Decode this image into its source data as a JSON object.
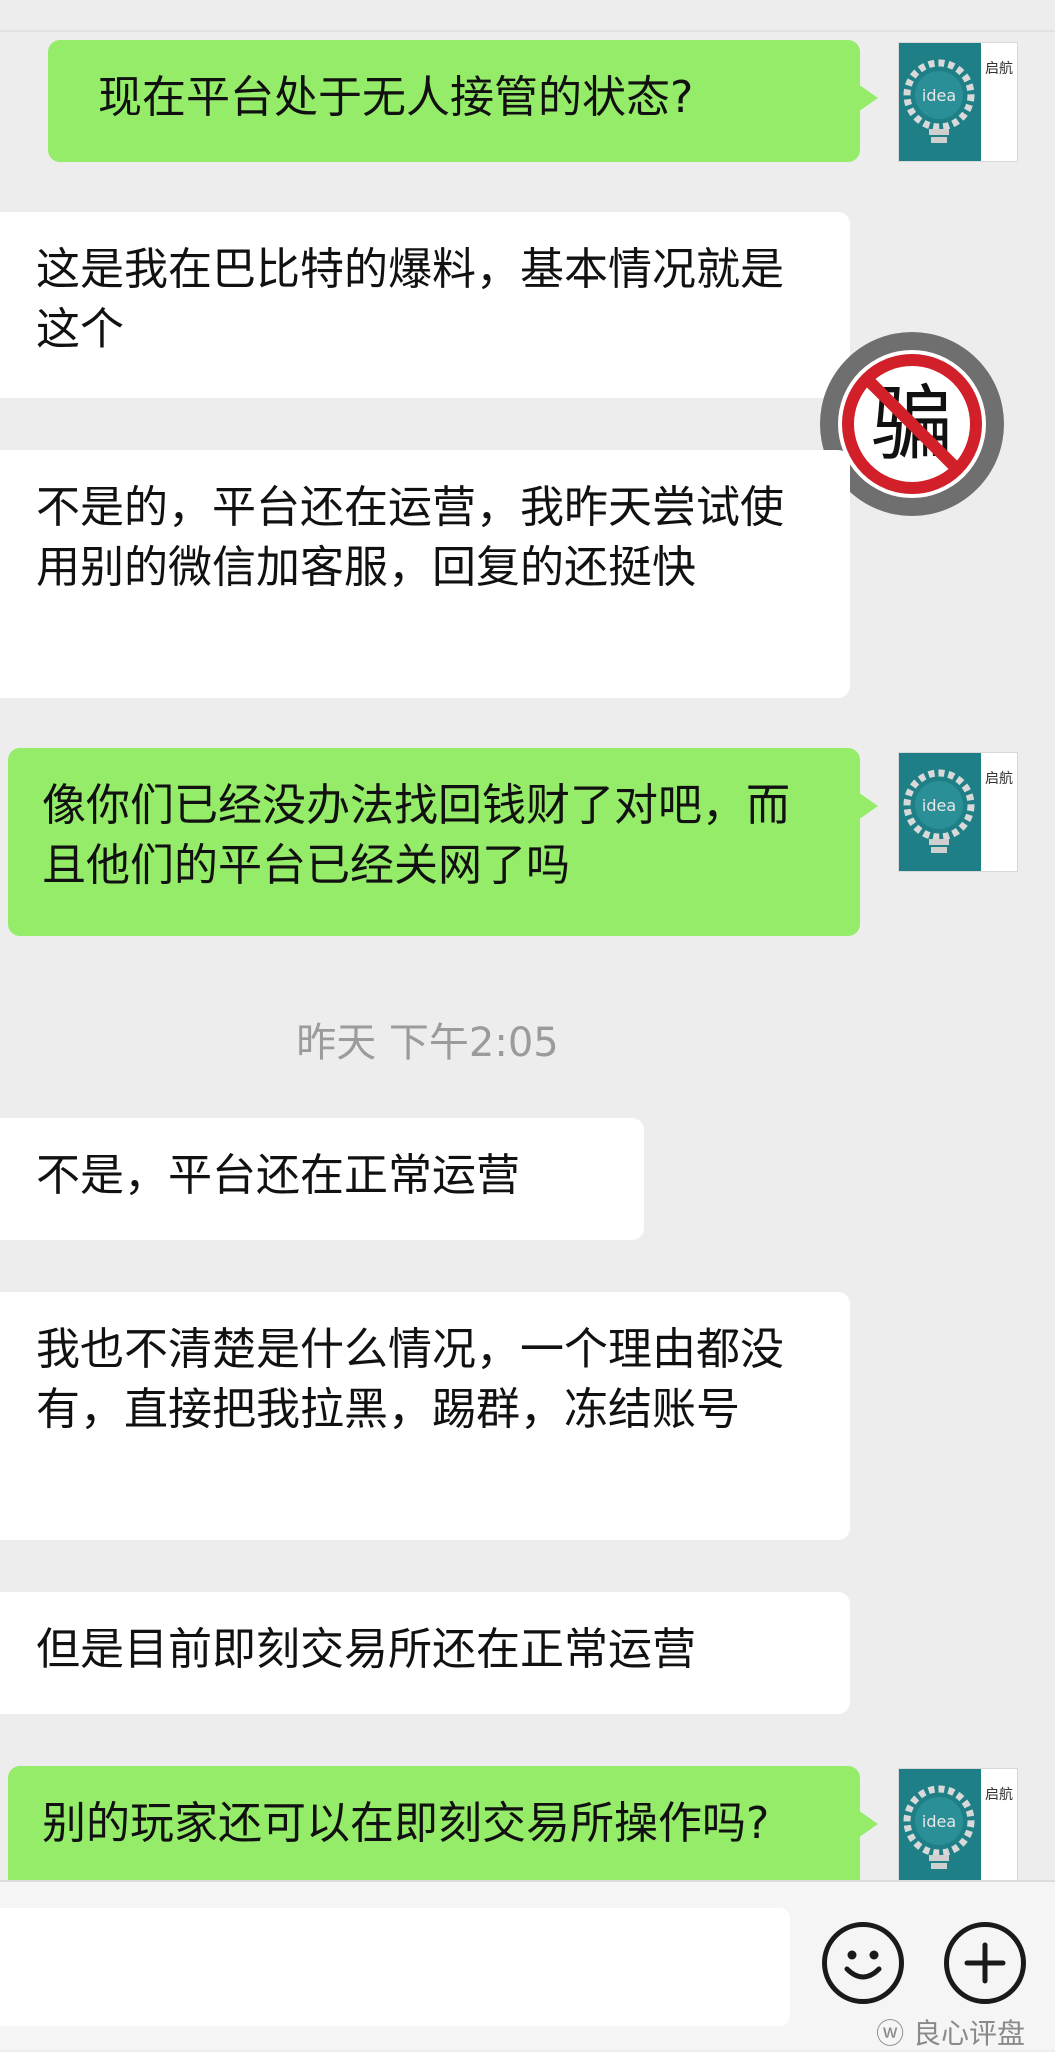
{
  "messages": [
    {
      "side": "right",
      "text": "现在平台处于无人接管的状态?"
    },
    {
      "side": "left",
      "text": "这是我在巴比特的爆料，基本情况就是这个"
    },
    {
      "side": "left",
      "text": "不是的，平台还在运营，我昨天尝试使用别的微信加客服，回复的还挺快"
    },
    {
      "side": "right",
      "text": "像你们已经没办法找回钱财了对吧，而且他们的平台已经关网了吗"
    },
    {
      "side": "left",
      "text": "不是，平台还在正常运营"
    },
    {
      "side": "left",
      "text": "我也不清楚是什么情况，一个理由都没有，直接把我拉黑，踢群，冻结账号"
    },
    {
      "side": "left",
      "text": "但是目前即刻交易所还在正常运营"
    },
    {
      "side": "right",
      "text": "别的玩家还可以在即刻交易所操作吗?"
    }
  ],
  "timestamp": "昨天 下午2:05",
  "avatar": {
    "word": "idea",
    "caption": "启航"
  },
  "sticker_char": "骗",
  "watermark": "良心评盘",
  "icons": {
    "emoji": "emoji-icon",
    "plus": "plus-icon"
  },
  "colors": {
    "background": "#ededed",
    "sent_bubble": "#95ec69",
    "received_bubble": "#ffffff"
  }
}
